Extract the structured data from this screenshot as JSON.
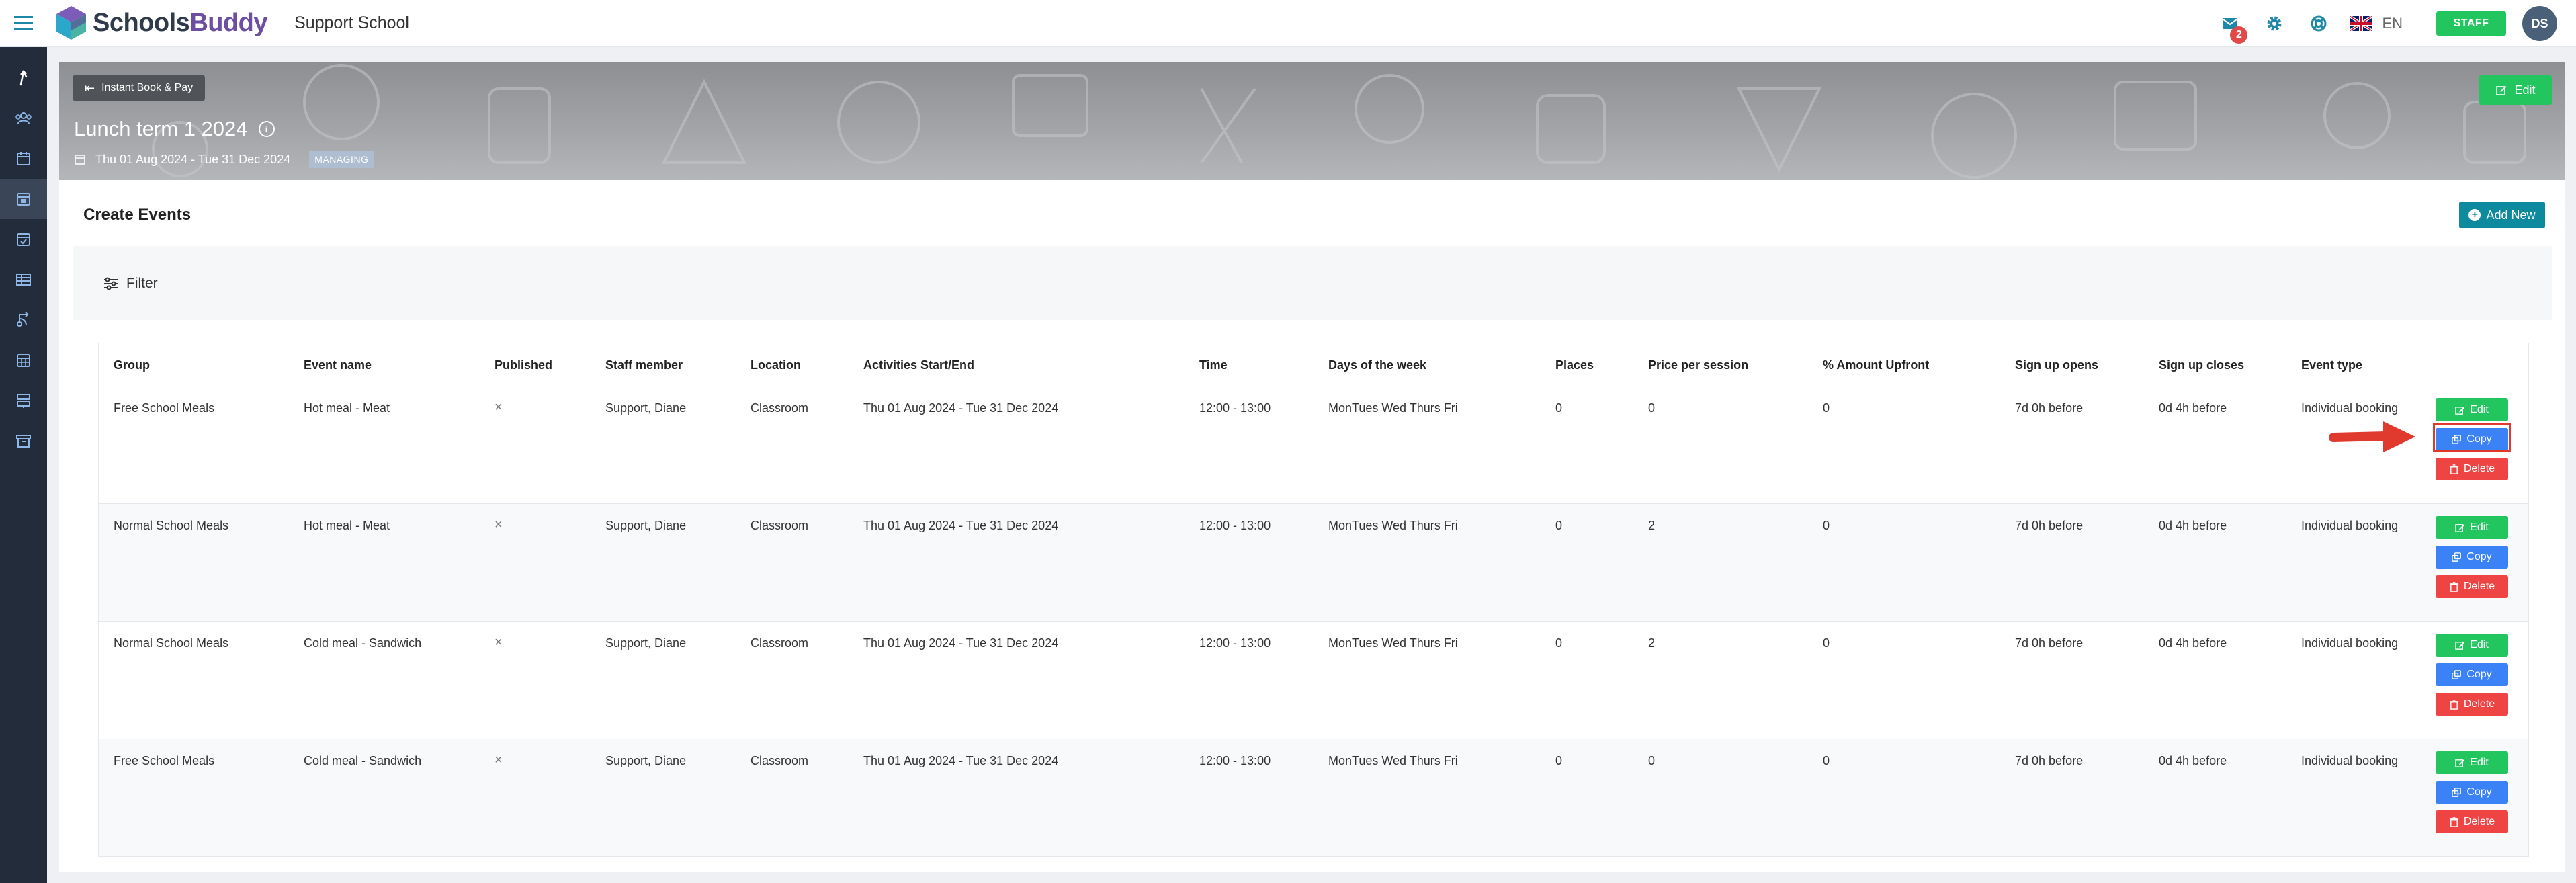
{
  "header": {
    "logo_text_1": "Schools",
    "logo_text_2": "Buddy",
    "school_name": "Support School",
    "mail_badge": "2",
    "language": "EN",
    "staff_label": "STAFF",
    "avatar_initials": "DS"
  },
  "sidebar": {
    "items": [
      "upload-icon",
      "people-icon",
      "calendar-icon",
      "calendar-check-icon",
      "calendar-tick-icon",
      "table-icon",
      "route-icon",
      "grid-calendar-icon",
      "server-icon",
      "archive-icon"
    ],
    "active_index": 3
  },
  "banner": {
    "back_label": "Instant Book & Pay",
    "title": "Lunch term 1 2024",
    "dates": "Thu 01 Aug 2024 - Tue 31 Dec 2024",
    "status_tag": "MANAGING",
    "edit_label": "Edit"
  },
  "main": {
    "section_title": "Create Events",
    "add_new_label": "Add New",
    "filter_label": "Filter"
  },
  "table": {
    "columns": [
      "Group",
      "Event name",
      "Published",
      "Staff member",
      "Location",
      "Activities Start/End",
      "Time",
      "Days of the week",
      "Places",
      "Price per session",
      "% Amount Upfront",
      "Sign up opens",
      "Sign up closes",
      "Event type"
    ],
    "rows": [
      [
        "Free School Meals",
        "Hot meal - Meat",
        "×",
        "Support, Diane",
        "Classroom",
        "Thu 01 Aug 2024 - Tue 31 Dec 2024",
        "12:00 - 13:00",
        "MonTues Wed Thurs Fri",
        "0",
        "0",
        "0",
        "7d 0h before",
        "0d 4h before",
        "Individual booking"
      ],
      [
        "Normal School Meals",
        "Hot meal - Meat",
        "×",
        "Support, Diane",
        "Classroom",
        "Thu 01 Aug 2024 - Tue 31 Dec 2024",
        "12:00 - 13:00",
        "MonTues Wed Thurs Fri",
        "0",
        "2",
        "0",
        "7d 0h before",
        "0d 4h before",
        "Individual booking"
      ],
      [
        "Normal School Meals",
        "Cold meal - Sandwich",
        "×",
        "Support, Diane",
        "Classroom",
        "Thu 01 Aug 2024 - Tue 31 Dec 2024",
        "12:00 - 13:00",
        "MonTues Wed Thurs Fri",
        "0",
        "2",
        "0",
        "7d 0h before",
        "0d 4h before",
        "Individual booking"
      ],
      [
        "Free School Meals",
        "Cold meal - Sandwich",
        "×",
        "Support, Diane",
        "Classroom",
        "Thu 01 Aug 2024 - Tue 31 Dec 2024",
        "12:00 - 13:00",
        "MonTues Wed Thurs Fri",
        "0",
        "0",
        "0",
        "7d 0h before",
        "0d 4h before",
        "Individual booking"
      ]
    ],
    "actions": {
      "edit": "Edit",
      "copy": "Copy",
      "delete": "Delete"
    }
  },
  "colors": {
    "brand_purple": "#6c4fa3",
    "teal": "#0d8a9e",
    "green": "#22c55e",
    "blue": "#3b82f6",
    "red": "#ef4444",
    "sidebar_bg": "#232c3b",
    "annotation_red": "#e0392d"
  }
}
